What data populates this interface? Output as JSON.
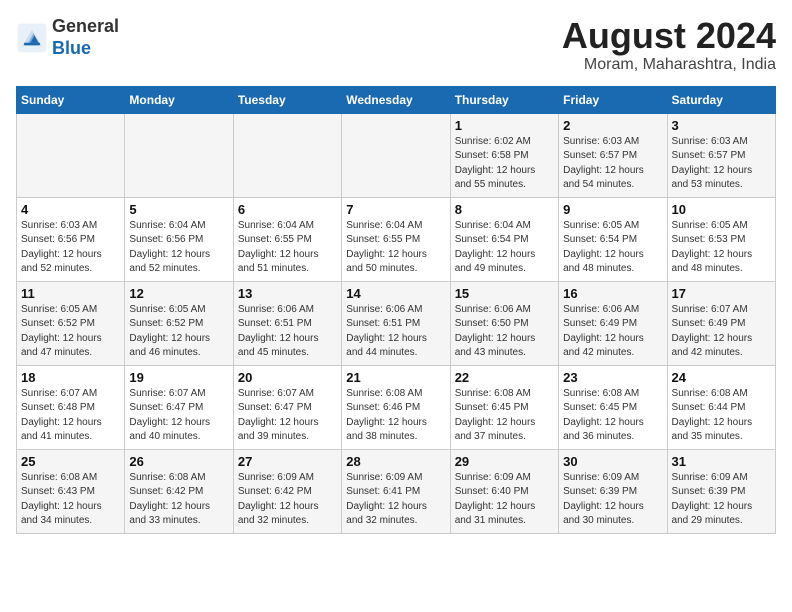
{
  "header": {
    "logo_line1": "General",
    "logo_line2": "Blue",
    "month_year": "August 2024",
    "location": "Moram, Maharashtra, India"
  },
  "weekdays": [
    "Sunday",
    "Monday",
    "Tuesday",
    "Wednesday",
    "Thursday",
    "Friday",
    "Saturday"
  ],
  "weeks": [
    [
      {
        "day": "",
        "info": ""
      },
      {
        "day": "",
        "info": ""
      },
      {
        "day": "",
        "info": ""
      },
      {
        "day": "",
        "info": ""
      },
      {
        "day": "1",
        "info": "Sunrise: 6:02 AM\nSunset: 6:58 PM\nDaylight: 12 hours\nand 55 minutes."
      },
      {
        "day": "2",
        "info": "Sunrise: 6:03 AM\nSunset: 6:57 PM\nDaylight: 12 hours\nand 54 minutes."
      },
      {
        "day": "3",
        "info": "Sunrise: 6:03 AM\nSunset: 6:57 PM\nDaylight: 12 hours\nand 53 minutes."
      }
    ],
    [
      {
        "day": "4",
        "info": "Sunrise: 6:03 AM\nSunset: 6:56 PM\nDaylight: 12 hours\nand 52 minutes."
      },
      {
        "day": "5",
        "info": "Sunrise: 6:04 AM\nSunset: 6:56 PM\nDaylight: 12 hours\nand 52 minutes."
      },
      {
        "day": "6",
        "info": "Sunrise: 6:04 AM\nSunset: 6:55 PM\nDaylight: 12 hours\nand 51 minutes."
      },
      {
        "day": "7",
        "info": "Sunrise: 6:04 AM\nSunset: 6:55 PM\nDaylight: 12 hours\nand 50 minutes."
      },
      {
        "day": "8",
        "info": "Sunrise: 6:04 AM\nSunset: 6:54 PM\nDaylight: 12 hours\nand 49 minutes."
      },
      {
        "day": "9",
        "info": "Sunrise: 6:05 AM\nSunset: 6:54 PM\nDaylight: 12 hours\nand 48 minutes."
      },
      {
        "day": "10",
        "info": "Sunrise: 6:05 AM\nSunset: 6:53 PM\nDaylight: 12 hours\nand 48 minutes."
      }
    ],
    [
      {
        "day": "11",
        "info": "Sunrise: 6:05 AM\nSunset: 6:52 PM\nDaylight: 12 hours\nand 47 minutes."
      },
      {
        "day": "12",
        "info": "Sunrise: 6:05 AM\nSunset: 6:52 PM\nDaylight: 12 hours\nand 46 minutes."
      },
      {
        "day": "13",
        "info": "Sunrise: 6:06 AM\nSunset: 6:51 PM\nDaylight: 12 hours\nand 45 minutes."
      },
      {
        "day": "14",
        "info": "Sunrise: 6:06 AM\nSunset: 6:51 PM\nDaylight: 12 hours\nand 44 minutes."
      },
      {
        "day": "15",
        "info": "Sunrise: 6:06 AM\nSunset: 6:50 PM\nDaylight: 12 hours\nand 43 minutes."
      },
      {
        "day": "16",
        "info": "Sunrise: 6:06 AM\nSunset: 6:49 PM\nDaylight: 12 hours\nand 42 minutes."
      },
      {
        "day": "17",
        "info": "Sunrise: 6:07 AM\nSunset: 6:49 PM\nDaylight: 12 hours\nand 42 minutes."
      }
    ],
    [
      {
        "day": "18",
        "info": "Sunrise: 6:07 AM\nSunset: 6:48 PM\nDaylight: 12 hours\nand 41 minutes."
      },
      {
        "day": "19",
        "info": "Sunrise: 6:07 AM\nSunset: 6:47 PM\nDaylight: 12 hours\nand 40 minutes."
      },
      {
        "day": "20",
        "info": "Sunrise: 6:07 AM\nSunset: 6:47 PM\nDaylight: 12 hours\nand 39 minutes."
      },
      {
        "day": "21",
        "info": "Sunrise: 6:08 AM\nSunset: 6:46 PM\nDaylight: 12 hours\nand 38 minutes."
      },
      {
        "day": "22",
        "info": "Sunrise: 6:08 AM\nSunset: 6:45 PM\nDaylight: 12 hours\nand 37 minutes."
      },
      {
        "day": "23",
        "info": "Sunrise: 6:08 AM\nSunset: 6:45 PM\nDaylight: 12 hours\nand 36 minutes."
      },
      {
        "day": "24",
        "info": "Sunrise: 6:08 AM\nSunset: 6:44 PM\nDaylight: 12 hours\nand 35 minutes."
      }
    ],
    [
      {
        "day": "25",
        "info": "Sunrise: 6:08 AM\nSunset: 6:43 PM\nDaylight: 12 hours\nand 34 minutes."
      },
      {
        "day": "26",
        "info": "Sunrise: 6:08 AM\nSunset: 6:42 PM\nDaylight: 12 hours\nand 33 minutes."
      },
      {
        "day": "27",
        "info": "Sunrise: 6:09 AM\nSunset: 6:42 PM\nDaylight: 12 hours\nand 32 minutes."
      },
      {
        "day": "28",
        "info": "Sunrise: 6:09 AM\nSunset: 6:41 PM\nDaylight: 12 hours\nand 32 minutes."
      },
      {
        "day": "29",
        "info": "Sunrise: 6:09 AM\nSunset: 6:40 PM\nDaylight: 12 hours\nand 31 minutes."
      },
      {
        "day": "30",
        "info": "Sunrise: 6:09 AM\nSunset: 6:39 PM\nDaylight: 12 hours\nand 30 minutes."
      },
      {
        "day": "31",
        "info": "Sunrise: 6:09 AM\nSunset: 6:39 PM\nDaylight: 12 hours\nand 29 minutes."
      }
    ]
  ]
}
